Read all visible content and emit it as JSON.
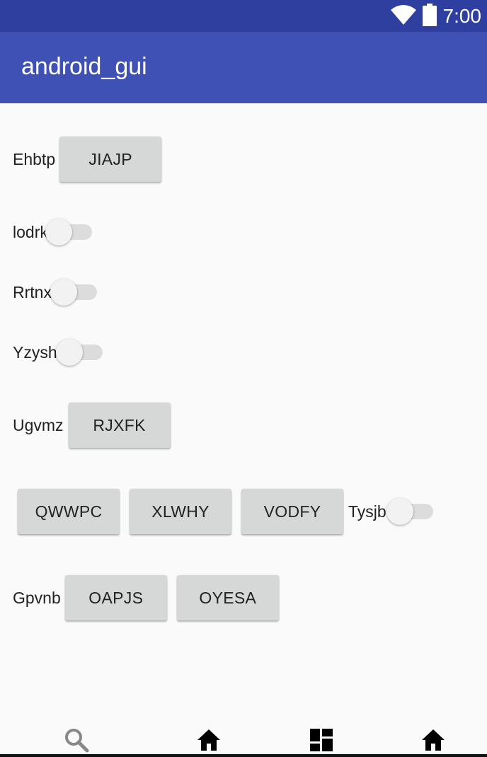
{
  "status_bar": {
    "time": "7:00"
  },
  "app_bar": {
    "title": "android_gui"
  },
  "rows": {
    "row1": {
      "label": "Ehbtp",
      "button": "JIAJP"
    },
    "row2": {
      "label": "lodrk"
    },
    "row3": {
      "label": "Rrtnx"
    },
    "row4": {
      "label": "Yzysh"
    },
    "row5": {
      "label": "Ugvmz",
      "button": "RJXFK"
    },
    "row6": {
      "buttons": [
        "QWWPC",
        "XLWHY",
        "VODFY"
      ],
      "label": "Tysjb"
    },
    "row7": {
      "label": "Gpvnb",
      "buttons": [
        "OAPJS",
        "OYESA"
      ]
    }
  },
  "bottom_nav": {
    "items": [
      "search-icon",
      "home-icon",
      "dashboard-icon",
      "home-icon"
    ]
  },
  "colors": {
    "status_bar": "#2f3fa0",
    "app_bar": "#3f51b5",
    "button": "#d6d7d7",
    "background": "#fafafa"
  }
}
